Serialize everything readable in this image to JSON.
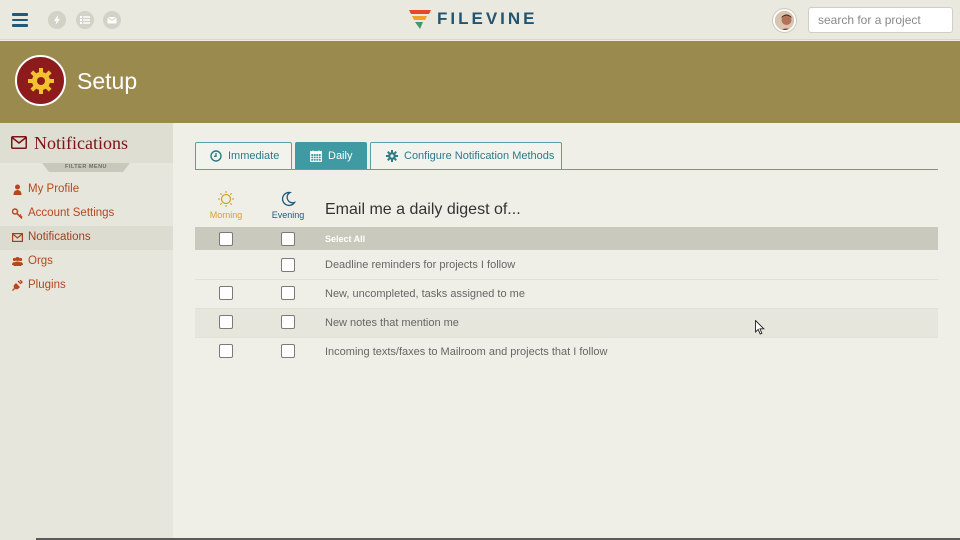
{
  "topbar": {
    "quick_icons": [
      "bolt-icon",
      "list-icon",
      "mail-icon"
    ],
    "logo_text": "FILEVINE",
    "search_placeholder": "search for a project"
  },
  "banner": {
    "title": "Setup",
    "icon": "gear-icon",
    "badge_color": "#8e1b1b"
  },
  "sidebar": {
    "title": "Notifications",
    "filter_label": "FILTER MENU",
    "items": [
      {
        "label": "My Profile",
        "icon": "person-icon"
      },
      {
        "label": "Account Settings",
        "icon": "key-icon"
      },
      {
        "label": "Notifications",
        "icon": "envelope-icon",
        "active": true
      },
      {
        "label": "Orgs",
        "icon": "group-icon"
      },
      {
        "label": "Plugins",
        "icon": "plug-icon"
      }
    ]
  },
  "tabs": [
    {
      "label": "Immediate",
      "icon": "clock-icon"
    },
    {
      "label": "Daily",
      "icon": "calendar-icon",
      "active": true
    },
    {
      "label": "Configure Notification Methods",
      "icon": "gear-icon"
    }
  ],
  "columns": {
    "morning": "Morning",
    "evening": "Evening"
  },
  "digest_title": "Email me a daily digest of...",
  "rows": [
    {
      "label": "Select All",
      "morning": false,
      "evening": false
    },
    {
      "label": "Deadline reminders for projects I follow",
      "evening": false
    },
    {
      "label": "New, uncompleted, tasks assigned to me",
      "morning": false,
      "evening": false
    },
    {
      "label": "New notes that mention me",
      "morning": false,
      "evening": false
    },
    {
      "label": "Incoming texts/faxes to Mailroom and projects that I follow",
      "morning": false,
      "evening": false
    }
  ],
  "colors": {
    "accent": "#3f9aa3",
    "banner": "#9b8a4e",
    "link": "#b8461d",
    "morning": "#d4a32a",
    "evening": "#1f5a7a"
  }
}
